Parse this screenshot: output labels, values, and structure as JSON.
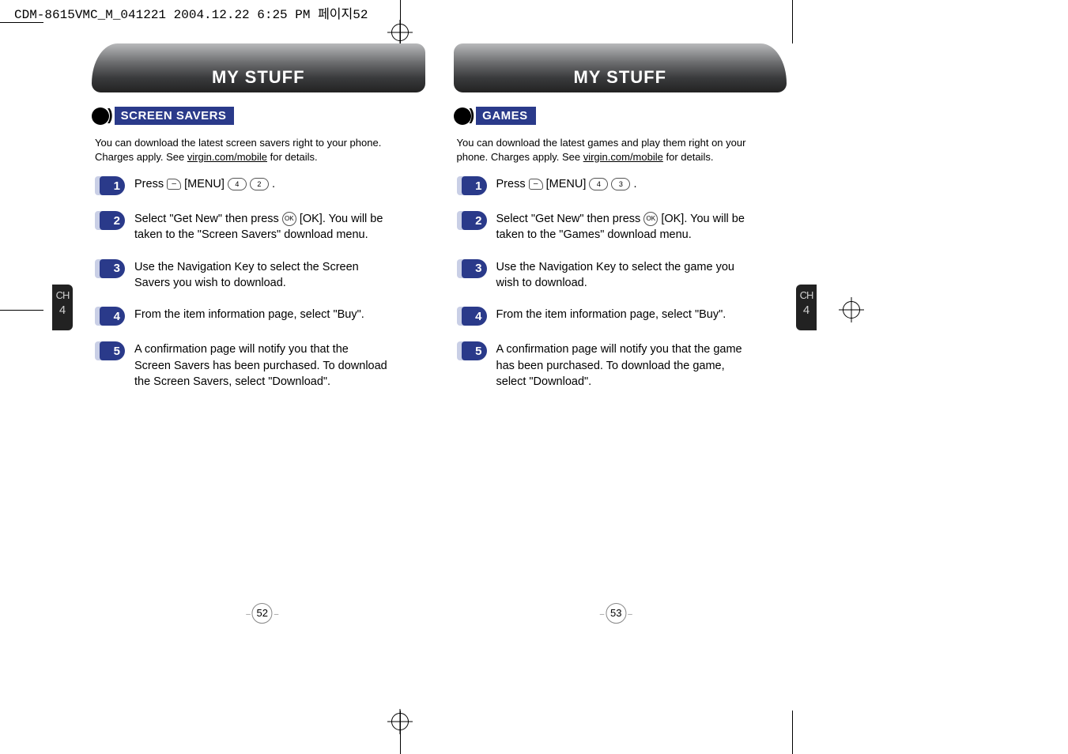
{
  "print_header": "CDM-8615VMC_M_041221  2004.12.22 6:25 PM  페이지52",
  "chapter_label": "CH",
  "chapter_number": "4",
  "left": {
    "title": "MY STUFF",
    "section": "SCREEN SAVERS",
    "intro_pre": "You can download the latest screen savers right to your phone. Charges apply. See ",
    "intro_link": "virgin.com/mobile",
    "intro_post": " for details.",
    "page_num": "52",
    "steps": [
      {
        "n": "1",
        "pre": "Press ",
        "keys": [
          "–",
          "MENU",
          "4",
          "2"
        ],
        "post": " ."
      },
      {
        "n": "2",
        "pre": "Select \"Get New\" then press ",
        "keys": [
          "OK"
        ],
        "post": " [OK]. You will be taken to the \"Screen Savers\" download menu."
      },
      {
        "n": "3",
        "pre": "Use the Navigation Key to select the Screen Savers you wish to download.",
        "keys": [],
        "post": ""
      },
      {
        "n": "4",
        "pre": "From the item information page, select \"Buy\".",
        "keys": [],
        "post": ""
      },
      {
        "n": "5",
        "pre": "A confirmation page will notify you that the Screen Savers has been purchased. To download the Screen Savers, select \"Download\".",
        "keys": [],
        "post": ""
      }
    ]
  },
  "right": {
    "title": "MY STUFF",
    "section": "GAMES",
    "intro_pre": "You can download the latest games and play them right on your phone. Charges apply. See ",
    "intro_link": "virgin.com/mobile",
    "intro_post": " for details.",
    "page_num": "53",
    "steps": [
      {
        "n": "1",
        "pre": "Press ",
        "keys": [
          "–",
          "MENU",
          "4",
          "3"
        ],
        "post": " ."
      },
      {
        "n": "2",
        "pre": "Select \"Get New\" then press ",
        "keys": [
          "OK"
        ],
        "post": " [OK]. You will be taken to the \"Games\" download menu."
      },
      {
        "n": "3",
        "pre": "Use the Navigation Key to select the game you wish to download.",
        "keys": [],
        "post": ""
      },
      {
        "n": "4",
        "pre": "From the item information page, select \"Buy\".",
        "keys": [],
        "post": ""
      },
      {
        "n": "5",
        "pre": "A confirmation page will notify you that the game has been purchased. To download the game, select \"Download\".",
        "keys": [],
        "post": ""
      }
    ]
  }
}
